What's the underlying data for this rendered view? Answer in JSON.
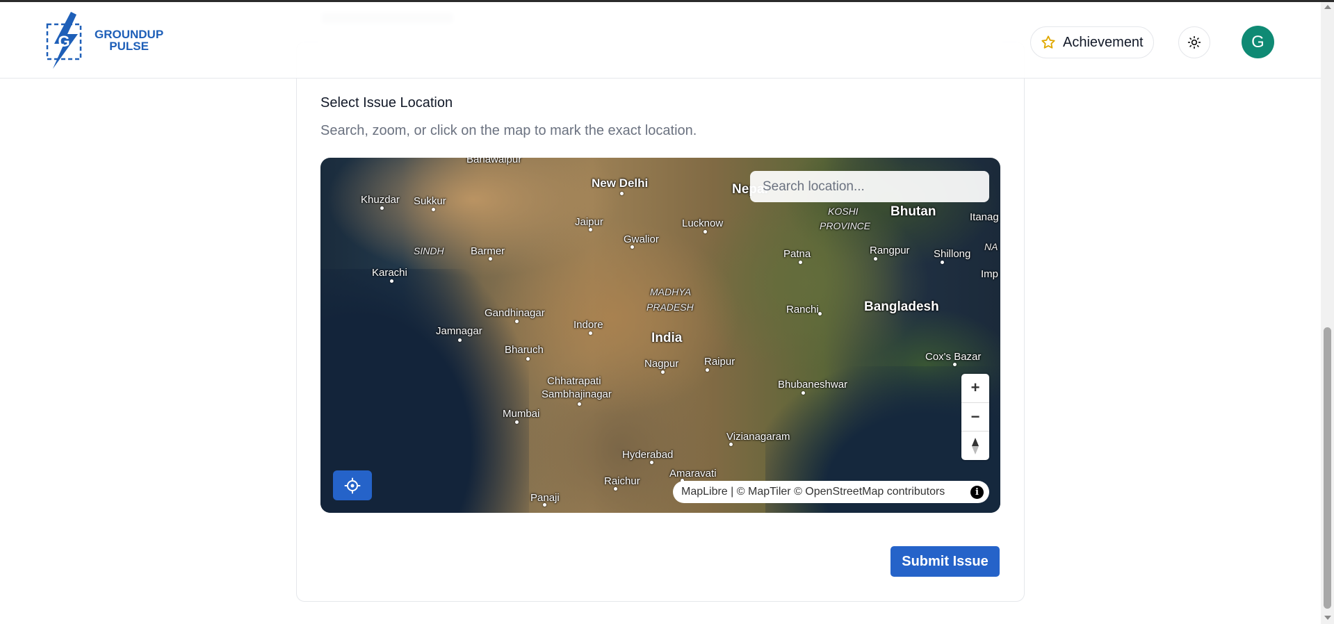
{
  "app": {
    "logo_line1": "GROUNDUP",
    "logo_line2": "PULSE",
    "brand_color": "#1e5fb8"
  },
  "header": {
    "achievement_label": "Achievement",
    "theme_icon": "sun-icon",
    "avatar_initial": "G",
    "avatar_color": "#0f8a74"
  },
  "section": {
    "title": "Select Issue Location",
    "subtitle": "Search, zoom, or click on the map to mark the exact location."
  },
  "map": {
    "search_placeholder": "Search location...",
    "zoom_in": "+",
    "zoom_out": "−",
    "reset_north": "compass-icon",
    "attribution": "MapLibre | © MapTiler © OpenStreetMap contributors",
    "labels": {
      "bahawalpur": "Bahawalpur",
      "new_delhi": "New Delhi",
      "nepal": "Nepal",
      "khuzdar": "Khuzdar",
      "sukkur": "Sukkur",
      "jaipur": "Jaipur",
      "lucknow": "Lucknow",
      "koshi": "KOSHI",
      "province": "PROVINCE",
      "bhutan": "Bhutan",
      "itanagar": "Itanag",
      "sindh": "SINDH",
      "barmer": "Barmer",
      "gwalior": "Gwalior",
      "patna": "Patna",
      "rangpur": "Rangpur",
      "shillong": "Shillong",
      "na": "NA",
      "karachi": "Karachi",
      "imphal": "Imp",
      "madhya": "MADHYA",
      "pradesh": "PRADESH",
      "ranchi": "Ranchi",
      "bangladesh": "Bangladesh",
      "gandhinagar": "Gandhinagar",
      "indore": "Indore",
      "jamnagar": "Jamnagar",
      "india": "India",
      "bharuch": "Bharuch",
      "coxs_bazar": "Cox's Bazar",
      "nagpur": "Nagpur",
      "raipur": "Raipur",
      "chhatrapati": "Chhatrapati",
      "sambhajinagar": "Sambhajinagar",
      "bhubaneswar": "Bhubaneshwar",
      "mumbai": "Mumbai",
      "visakhapatnam": "Vizianagaram",
      "hyderabad": "Hyderabad",
      "amaravati": "Amaravati",
      "raichur": "Raichur",
      "panaji": "Panaji"
    }
  },
  "form": {
    "submit_label": "Submit Issue",
    "accent": "#2563c9"
  }
}
